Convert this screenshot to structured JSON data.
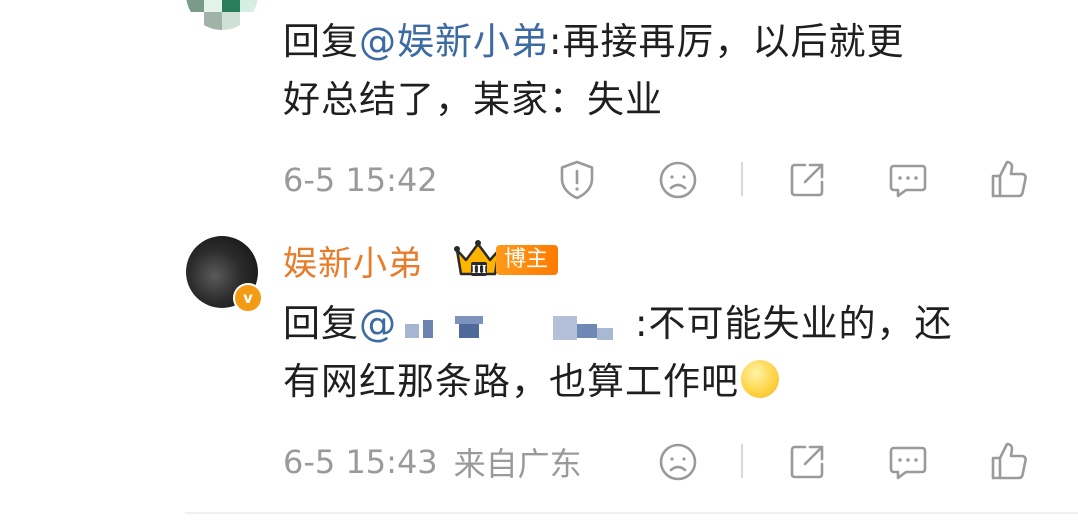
{
  "comment1": {
    "reply_prefix": "回复",
    "mention": "@娱新小弟",
    "text_line1_rest": ":再接再厉，以后就更",
    "text_line2": "好总结了，某家：失业",
    "time": "6-5 15:42",
    "icons": [
      "report-icon",
      "sad-face-icon",
      "share-icon",
      "comment-icon",
      "like-icon"
    ]
  },
  "comment2": {
    "username": "娱新小弟",
    "badge_level": "III",
    "badge_label": "博主",
    "verified_mark": "v",
    "reply_prefix": "回复",
    "mention_at": "@",
    "text_line1_rest": ":不可能失业的，还",
    "text_line2": "有网红那条路，也算工作吧",
    "time": "6-5 15:43",
    "location": "来自广东",
    "icons": [
      "sad-face-icon",
      "share-icon",
      "comment-icon",
      "like-icon"
    ]
  },
  "colors": {
    "text": "#1f1f1f",
    "mention": "#3c6aa3",
    "username": "#e77c2a",
    "meta": "#9a9a9a",
    "icon": "#9a9a9a",
    "badge": "#ff8a00"
  }
}
